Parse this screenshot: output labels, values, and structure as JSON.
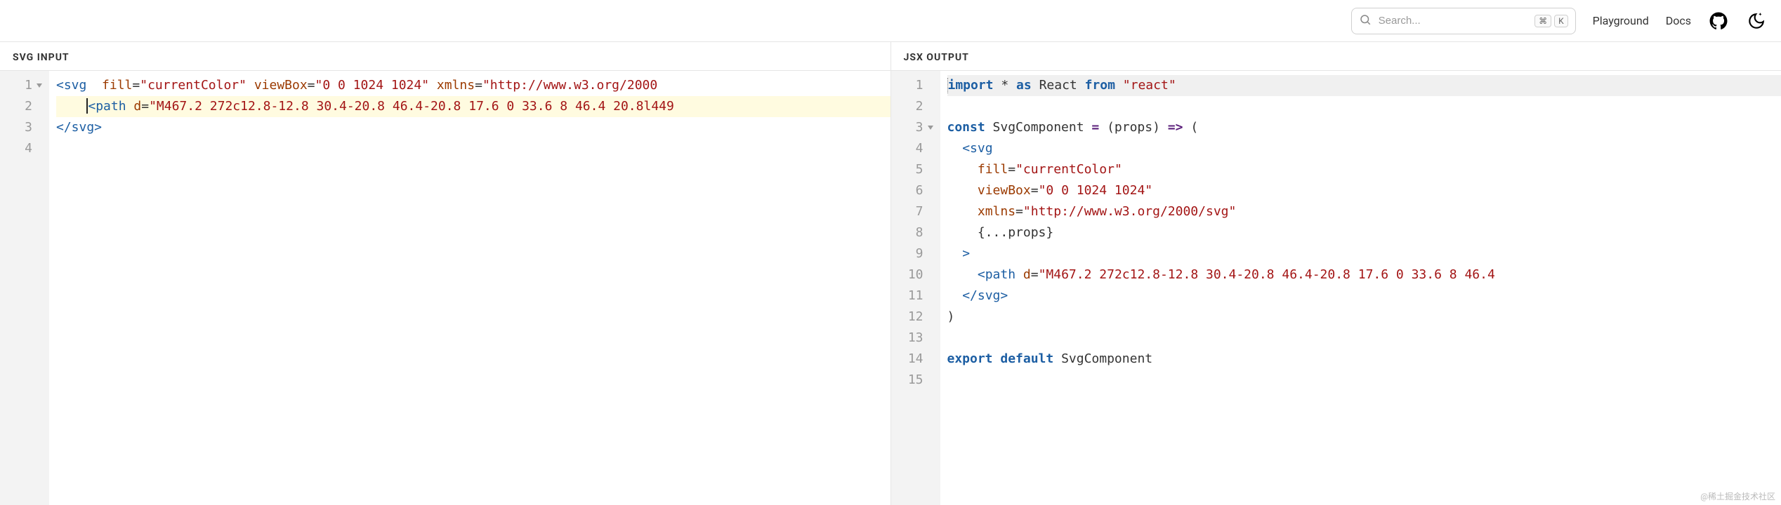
{
  "header": {
    "search": {
      "placeholder": "Search...",
      "kbd1": "⌘",
      "kbd2": "K"
    },
    "nav": {
      "playground": "Playground",
      "docs": "Docs"
    }
  },
  "panels": {
    "left": {
      "title": "SVG INPUT"
    },
    "right": {
      "title": "JSX OUTPUT"
    }
  },
  "input_code": {
    "lines": [
      {
        "n": "1",
        "fold": true,
        "hl": false,
        "tokens": [
          {
            "t": "<svg",
            "c": "tag"
          },
          {
            "t": "  ",
            "c": "pn"
          },
          {
            "t": "fill",
            "c": "attr"
          },
          {
            "t": "=",
            "c": "pn"
          },
          {
            "t": "\"currentColor\"",
            "c": "str"
          },
          {
            "t": " ",
            "c": "pn"
          },
          {
            "t": "viewBox",
            "c": "attr"
          },
          {
            "t": "=",
            "c": "pn"
          },
          {
            "t": "\"0 0 1024 1024\"",
            "c": "str"
          },
          {
            "t": " ",
            "c": "pn"
          },
          {
            "t": "xmlns",
            "c": "attr"
          },
          {
            "t": "=",
            "c": "pn"
          },
          {
            "t": "\"http://www.w3.org/2000",
            "c": "str"
          }
        ]
      },
      {
        "n": "2",
        "fold": false,
        "hl": true,
        "tokens": [
          {
            "t": "    ",
            "c": "pn"
          },
          {
            "t": "<path",
            "c": "tag"
          },
          {
            "t": " ",
            "c": "pn"
          },
          {
            "t": "d",
            "c": "attr"
          },
          {
            "t": "=",
            "c": "pn"
          },
          {
            "t": "\"M467.2 272c12.8-12.8 30.4-20.8 46.4-20.8 17.6 0 33.6 8 46.4 20.8l449",
            "c": "str"
          }
        ]
      },
      {
        "n": "3",
        "fold": false,
        "hl": false,
        "tokens": [
          {
            "t": "</svg>",
            "c": "tag"
          }
        ]
      },
      {
        "n": "4",
        "fold": false,
        "hl": false,
        "tokens": []
      }
    ]
  },
  "output_code": {
    "lines": [
      {
        "n": "1",
        "fold": false,
        "tokens": [
          {
            "t": "import",
            "c": "kw"
          },
          {
            "t": " * ",
            "c": "pn"
          },
          {
            "t": "as",
            "c": "kw"
          },
          {
            "t": " React ",
            "c": "id"
          },
          {
            "t": "from",
            "c": "kw"
          },
          {
            "t": " ",
            "c": "pn"
          },
          {
            "t": "\"react\"",
            "c": "str"
          }
        ]
      },
      {
        "n": "2",
        "fold": false,
        "tokens": []
      },
      {
        "n": "3",
        "fold": true,
        "tokens": [
          {
            "t": "const",
            "c": "kw"
          },
          {
            "t": " SvgComponent ",
            "c": "id"
          },
          {
            "t": "=",
            "c": "op"
          },
          {
            "t": " (props) ",
            "c": "id"
          },
          {
            "t": "=>",
            "c": "op"
          },
          {
            "t": " (",
            "c": "pn"
          }
        ]
      },
      {
        "n": "4",
        "fold": false,
        "tokens": [
          {
            "t": "  ",
            "c": "pn"
          },
          {
            "t": "<svg",
            "c": "tag"
          }
        ]
      },
      {
        "n": "5",
        "fold": false,
        "tokens": [
          {
            "t": "    ",
            "c": "pn"
          },
          {
            "t": "fill",
            "c": "attr"
          },
          {
            "t": "=",
            "c": "pn"
          },
          {
            "t": "\"currentColor\"",
            "c": "str"
          }
        ]
      },
      {
        "n": "6",
        "fold": false,
        "tokens": [
          {
            "t": "    ",
            "c": "pn"
          },
          {
            "t": "viewBox",
            "c": "attr"
          },
          {
            "t": "=",
            "c": "pn"
          },
          {
            "t": "\"0 0 1024 1024\"",
            "c": "str"
          }
        ]
      },
      {
        "n": "7",
        "fold": false,
        "tokens": [
          {
            "t": "    ",
            "c": "pn"
          },
          {
            "t": "xmlns",
            "c": "attr"
          },
          {
            "t": "=",
            "c": "pn"
          },
          {
            "t": "\"http://www.w3.org/2000/svg\"",
            "c": "str"
          }
        ]
      },
      {
        "n": "8",
        "fold": false,
        "tokens": [
          {
            "t": "    {...props}",
            "c": "pn"
          }
        ]
      },
      {
        "n": "9",
        "fold": false,
        "tokens": [
          {
            "t": "  ",
            "c": "pn"
          },
          {
            "t": ">",
            "c": "tag"
          }
        ]
      },
      {
        "n": "10",
        "fold": false,
        "tokens": [
          {
            "t": "    ",
            "c": "pn"
          },
          {
            "t": "<path",
            "c": "tag"
          },
          {
            "t": " ",
            "c": "pn"
          },
          {
            "t": "d",
            "c": "attr"
          },
          {
            "t": "=",
            "c": "pn"
          },
          {
            "t": "\"M467.2 272c12.8-12.8 30.4-20.8 46.4-20.8 17.6 0 33.6 8 46.4",
            "c": "str"
          }
        ]
      },
      {
        "n": "11",
        "fold": false,
        "tokens": [
          {
            "t": "  ",
            "c": "pn"
          },
          {
            "t": "</svg>",
            "c": "tag"
          }
        ]
      },
      {
        "n": "12",
        "fold": false,
        "tokens": [
          {
            "t": ")",
            "c": "pn"
          }
        ]
      },
      {
        "n": "13",
        "fold": false,
        "tokens": []
      },
      {
        "n": "14",
        "fold": false,
        "tokens": [
          {
            "t": "export",
            "c": "kw"
          },
          {
            "t": " ",
            "c": "pn"
          },
          {
            "t": "default",
            "c": "kw"
          },
          {
            "t": " SvgComponent",
            "c": "id"
          }
        ]
      },
      {
        "n": "15",
        "fold": false,
        "tokens": []
      }
    ]
  },
  "watermark": "@稀土掘金技术社区"
}
